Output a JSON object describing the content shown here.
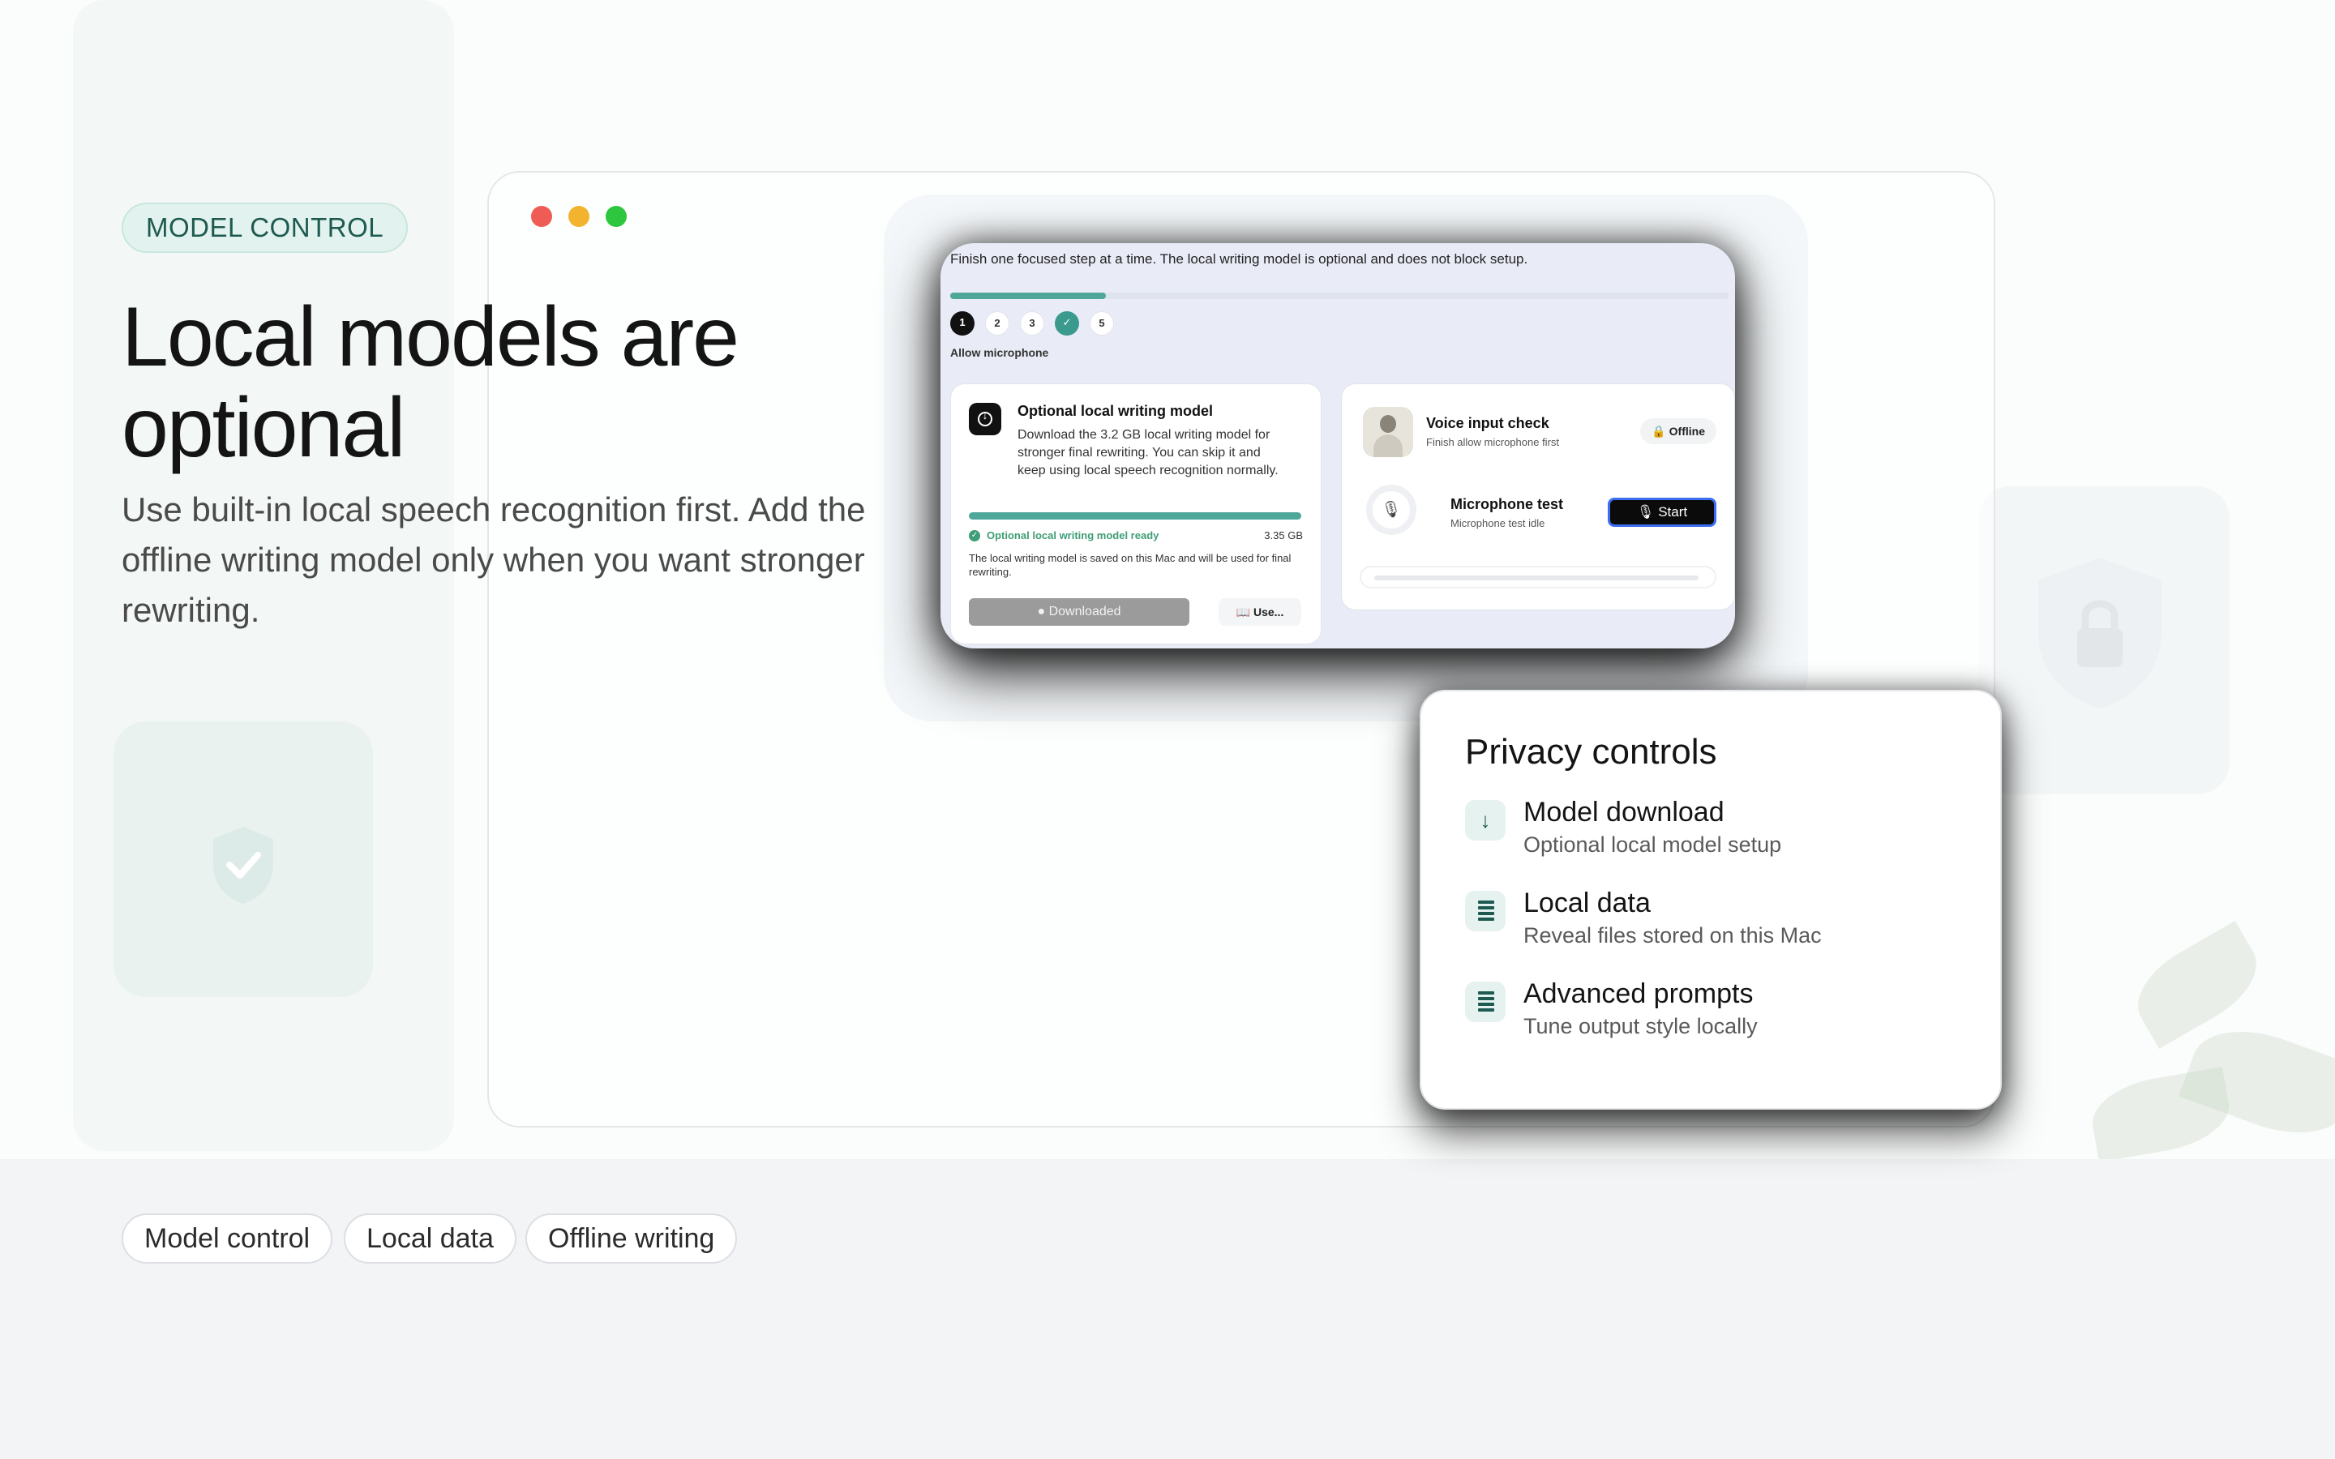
{
  "hero": {
    "badge": "MODEL CONTROL",
    "title": "Local models are optional",
    "subtitle": "Use built-in local speech recognition first. Add the offline writing model only when you want stronger rewriting."
  },
  "window": {
    "traffic_lights": [
      "#ee5c55",
      "#f2b32e",
      "#2ec63f"
    ]
  },
  "setup": {
    "intro": "Finish one focused step at a time. The local writing model is optional and does not block setup.",
    "progress_fraction": 0.2,
    "steps": [
      {
        "label": "1",
        "state": "active"
      },
      {
        "label": "2",
        "state": "todo"
      },
      {
        "label": "3",
        "state": "todo"
      },
      {
        "label": "✓",
        "state": "done"
      },
      {
        "label": "5",
        "state": "todo"
      }
    ],
    "current_step_label": "Allow microphone",
    "model_card": {
      "icon": "download-icon",
      "title": "Optional local writing model",
      "description": "Download the 3.2 GB local writing model for stronger final rewriting. You can skip it and keep using local speech recognition normally.",
      "status": "Optional local writing model ready",
      "size": "3.35 GB",
      "note": "The local writing model is saved on this Mac and will be used for final rewriting.",
      "downloaded_button": "Downloaded",
      "use_button": "Use..."
    },
    "voice_card": {
      "title": "Voice input check",
      "subtitle": "Finish allow microphone first",
      "offline_badge": "Offline",
      "mic_title": "Microphone test",
      "mic_status": "Microphone test idle",
      "start_button": "Start"
    }
  },
  "privacy": {
    "title": "Privacy controls",
    "items": [
      {
        "icon": "arrow-down-icon",
        "label": "Model download",
        "description": "Optional local model setup"
      },
      {
        "icon": "document-lines-icon",
        "label": "Local data",
        "description": "Reveal files stored on this Mac"
      },
      {
        "icon": "document-lines-icon",
        "label": "Advanced prompts",
        "description": "Tune output style locally"
      }
    ]
  },
  "tags": [
    "Model control",
    "Local data",
    "Offline writing"
  ],
  "colors": {
    "accent": "#4fa79a",
    "badge_bg": "#e2f3ef",
    "ready_green": "#3f9d77",
    "footer_bg": "#f3f4f6"
  }
}
